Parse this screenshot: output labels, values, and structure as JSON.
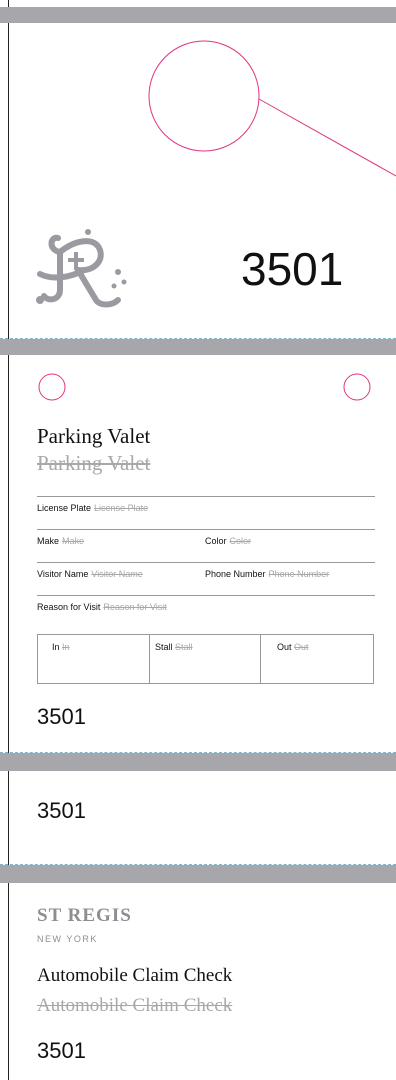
{
  "tag_number": "3501",
  "colors": {
    "band": "#a7a6ab",
    "hole": "#e0347f",
    "ghost": "#a8a8a8",
    "cut_line": "#7fb6cc"
  },
  "top_tag": {
    "number": "3501",
    "logo": "st-regis-monogram"
  },
  "valet_section": {
    "title": "Parking Valet",
    "title_ghost": "Parking Valet",
    "fields": {
      "license_plate": {
        "label": "License Plate",
        "placeholder": "License Plate"
      },
      "make": {
        "label": "Make",
        "placeholder": "Make"
      },
      "color": {
        "label": "Color",
        "placeholder": "Color"
      },
      "visitor_name": {
        "label": "Visitor Name",
        "placeholder": "Visitor Name"
      },
      "phone_number": {
        "label": "Phone Number",
        "placeholder": "Phone Number"
      },
      "reason": {
        "label": "Reason for Visit",
        "placeholder": "Reason for Visit"
      }
    },
    "grid": {
      "in": {
        "label": "In",
        "placeholder": "In"
      },
      "stall": {
        "label": "Stall",
        "placeholder": "Stall"
      },
      "out": {
        "label": "Out",
        "placeholder": "Out"
      }
    },
    "number": "3501"
  },
  "stub": {
    "number": "3501"
  },
  "claim_section": {
    "brand": "ST REGIS",
    "brand_sub": "NEW YORK",
    "title": "Automobile Claim Check",
    "title_ghost": "Automobile Claim Check",
    "number": "3501"
  }
}
